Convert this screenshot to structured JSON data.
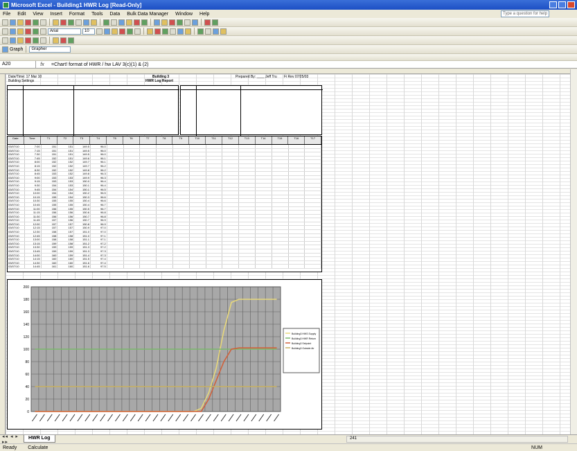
{
  "window": {
    "title": "Microsoft Excel - Building1 HWR Log [Read-Only]"
  },
  "menu": {
    "items": [
      "File",
      "Edit",
      "View",
      "Insert",
      "Format",
      "Tools",
      "Data",
      "Bulk Data Manager",
      "Window",
      "Help"
    ],
    "help_placeholder": "Type a question for help"
  },
  "toolbar": {
    "font_name": "Arial",
    "font_size": "10",
    "zoom": "Grapher",
    "security_label": "Graph"
  },
  "formula_bar": {
    "name_box": "A20",
    "fx": "fx",
    "content": "=Chart! format of HWR / hw LAV 3(c)(1) & (2)"
  },
  "report": {
    "header_left_1": "Date/Time: 17 Mar 10",
    "header_left_2": "Building Settings",
    "title_1": "Building 3",
    "title_2": "HWR Log Report",
    "header_right_1": "Prepared By: ____ Jeff Tru",
    "header_right_2": "Fi Rev 07/25/03",
    "table_headers": [
      "Date",
      "Time",
      "T1",
      "T2",
      "T3",
      "T4",
      "T5",
      "T6",
      "T7",
      "T8",
      "T9",
      "T10",
      "T11",
      "T12",
      "T13",
      "T14",
      "T15",
      "T16",
      "T17"
    ],
    "rows": [
      [
        "03/07/10",
        "7:00",
        "151",
        "151",
        "149.5",
        "96.0"
      ],
      [
        "03/07/10",
        "7:15",
        "151",
        "151",
        "149.5",
        "96.0"
      ],
      [
        "03/07/10",
        "7:30",
        "151",
        "151",
        "149.5",
        "96.0"
      ],
      [
        "03/07/10",
        "7:45",
        "152",
        "151",
        "149.6",
        "96.1"
      ],
      [
        "03/07/10",
        "8:00",
        "152",
        "152",
        "149.7",
        "96.1"
      ],
      [
        "03/07/10",
        "8:15",
        "152",
        "152",
        "149.7",
        "96.2"
      ],
      [
        "03/07/10",
        "8:30",
        "152",
        "152",
        "149.8",
        "96.2"
      ],
      [
        "03/07/10",
        "8:45",
        "153",
        "152",
        "149.8",
        "96.3"
      ],
      [
        "03/07/10",
        "9:00",
        "153",
        "153",
        "149.9",
        "96.3"
      ],
      [
        "03/07/10",
        "9:15",
        "153",
        "153",
        "150.0",
        "96.4"
      ],
      [
        "03/07/10",
        "9:30",
        "154",
        "153",
        "150.1",
        "96.4"
      ],
      [
        "03/07/10",
        "9:45",
        "154",
        "154",
        "150.1",
        "96.5"
      ],
      [
        "03/07/10",
        "10:00",
        "154",
        "154",
        "150.2",
        "96.5"
      ],
      [
        "03/07/10",
        "10:15",
        "155",
        "154",
        "150.3",
        "96.6"
      ],
      [
        "03/07/10",
        "10:30",
        "155",
        "155",
        "150.4",
        "96.6"
      ],
      [
        "03/07/10",
        "10:45",
        "155",
        "155",
        "150.4",
        "96.7"
      ],
      [
        "03/07/10",
        "11:00",
        "156",
        "155",
        "150.5",
        "96.7"
      ],
      [
        "03/07/10",
        "11:15",
        "156",
        "156",
        "150.6",
        "96.8"
      ],
      [
        "03/07/10",
        "11:30",
        "156",
        "156",
        "150.7",
        "96.8"
      ],
      [
        "03/07/10",
        "11:45",
        "157",
        "156",
        "150.7",
        "96.9"
      ],
      [
        "03/07/10",
        "12:00",
        "157",
        "157",
        "150.8",
        "96.9"
      ],
      [
        "03/07/10",
        "12:15",
        "157",
        "157",
        "150.9",
        "97.0"
      ],
      [
        "03/07/10",
        "12:30",
        "158",
        "157",
        "151.0",
        "97.0"
      ],
      [
        "03/07/10",
        "12:45",
        "158",
        "158",
        "151.0",
        "97.1"
      ],
      [
        "03/07/10",
        "13:00",
        "158",
        "158",
        "151.1",
        "97.1"
      ],
      [
        "03/07/10",
        "13:15",
        "159",
        "158",
        "151.2",
        "97.2"
      ],
      [
        "03/07/10",
        "13:30",
        "159",
        "159",
        "151.3",
        "97.2"
      ],
      [
        "03/07/10",
        "13:45",
        "159",
        "159",
        "151.3",
        "97.3"
      ],
      [
        "03/07/10",
        "14:00",
        "160",
        "159",
        "151.4",
        "97.3"
      ],
      [
        "03/07/10",
        "14:15",
        "160",
        "160",
        "151.5",
        "97.4"
      ],
      [
        "03/07/10",
        "14:30",
        "160",
        "160",
        "151.6",
        "97.4"
      ],
      [
        "03/07/10",
        "14:45",
        "161",
        "160",
        "151.6",
        "97.5"
      ]
    ]
  },
  "chart_data": {
    "type": "line",
    "y_ticks": [
      "200",
      "180",
      "160",
      "140",
      "120",
      "100",
      "80",
      "60",
      "40",
      "20",
      "0"
    ],
    "ylim": [
      0,
      200
    ],
    "legend_placement": "right",
    "legend": [
      "Building3 HWS Supply",
      "Building3 HWR Return",
      "Building3 Setpoint",
      "Building3 Outside Air"
    ],
    "series": [
      {
        "color": "#e8d87a",
        "values": [
          0,
          0,
          0,
          0,
          0,
          0,
          0,
          0,
          0,
          0,
          0,
          0,
          0,
          0,
          0,
          0,
          0,
          0,
          0,
          0,
          0,
          0,
          5,
          30,
          70,
          130,
          175,
          180,
          180,
          180,
          180,
          180,
          180
        ]
      },
      {
        "color": "#7ab86a",
        "values": [
          100,
          100,
          100,
          100,
          100,
          100,
          100,
          100,
          100,
          100,
          100,
          100,
          100,
          100,
          100,
          100,
          100,
          100,
          100,
          100,
          100,
          100,
          100,
          100,
          100,
          100,
          100,
          100,
          100,
          100,
          100,
          100,
          100
        ]
      },
      {
        "color": "#d0603a",
        "values": [
          0,
          0,
          0,
          0,
          0,
          0,
          0,
          0,
          0,
          0,
          0,
          0,
          0,
          0,
          0,
          0,
          0,
          0,
          0,
          0,
          0,
          0,
          0,
          20,
          50,
          80,
          100,
          102,
          102,
          102,
          102,
          102,
          102
        ]
      },
      {
        "color": "#c8b060",
        "values": [
          40,
          40,
          40,
          40,
          40,
          40,
          40,
          40,
          40,
          40,
          40,
          40,
          40,
          40,
          40,
          40,
          40,
          40,
          40,
          40,
          40,
          40,
          40,
          40,
          40,
          40,
          40,
          40,
          40,
          40,
          40,
          40,
          40
        ]
      }
    ]
  },
  "sheet_tabs": {
    "nav": "◂◂ ◂ ▸ ▸▸",
    "active_tab": "HWR Log",
    "hscroll_label": "241"
  },
  "status": {
    "left": "Ready",
    "middle": "Calculate",
    "right": "NUM"
  }
}
